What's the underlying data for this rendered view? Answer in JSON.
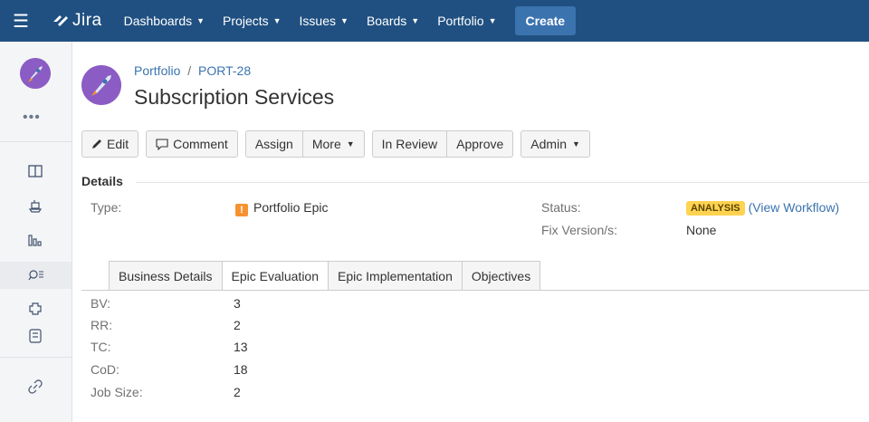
{
  "topnav": {
    "logo_text": "Jira",
    "items": [
      {
        "label": "Dashboards"
      },
      {
        "label": "Projects"
      },
      {
        "label": "Issues"
      },
      {
        "label": "Boards"
      },
      {
        "label": "Portfolio"
      }
    ],
    "create_label": "Create"
  },
  "sidebar": {
    "more_label": "•••",
    "icons": [
      "board-icon",
      "releases-icon",
      "reports-icon",
      "issues-search-icon",
      "add-ons-icon",
      "project-pages-icon",
      "link-icon"
    ]
  },
  "issue": {
    "breadcrumb_project": "Portfolio",
    "breadcrumb_sep": "/",
    "breadcrumb_key": "PORT-28",
    "title": "Subscription Services"
  },
  "toolbar": {
    "edit": "Edit",
    "comment": "Comment",
    "assign": "Assign",
    "more": "More",
    "in_review": "In Review",
    "approve": "Approve",
    "admin": "Admin"
  },
  "details": {
    "heading": "Details",
    "type_label": "Type:",
    "type_value": "Portfolio Epic",
    "type_icon_glyph": "!",
    "status_label": "Status:",
    "status_value": "ANALYSIS",
    "status_link": "(View Workflow)",
    "fix_label": "Fix Version/s:",
    "fix_value": "None"
  },
  "tabs": [
    {
      "label": "Business Details"
    },
    {
      "label": "Epic Evaluation"
    },
    {
      "label": "Epic Implementation"
    },
    {
      "label": "Objectives"
    }
  ],
  "fields": [
    {
      "label": "BV:",
      "value": "3"
    },
    {
      "label": "RR:",
      "value": "2"
    },
    {
      "label": "TC:",
      "value": "13"
    },
    {
      "label": "CoD:",
      "value": "18"
    },
    {
      "label": "Job Size:",
      "value": "2"
    }
  ],
  "colors": {
    "nav_bg": "#205081",
    "create_bg": "#3b73af",
    "link": "#3b73af",
    "lozenge_bg": "#ffd351",
    "epic_icon": "#f79232",
    "avatar": "#8b5cc4"
  }
}
